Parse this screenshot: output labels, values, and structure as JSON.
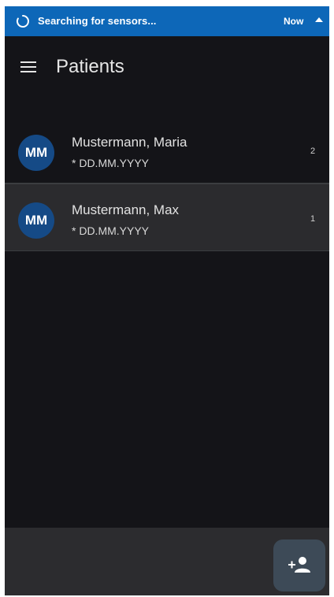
{
  "notification": {
    "message": "Searching for sensors...",
    "time": "Now",
    "spinner_icon": "loading-spinner-icon",
    "expand_icon": "caret-up-icon",
    "color": "#0d67b8"
  },
  "appbar": {
    "title": "Patients",
    "menu_icon": "hamburger-menu-icon"
  },
  "patients": [
    {
      "initials": "MM",
      "name": "Mustermann, Maria",
      "birth_date": "* DD.MM.YYYY",
      "count": "2",
      "selected": false
    },
    {
      "initials": "MM",
      "name": "Mustermann, Max",
      "birth_date": "* DD.MM.YYYY",
      "count": "1",
      "selected": true
    }
  ],
  "fab": {
    "icon": "add-person-icon"
  },
  "colors": {
    "background": "#141418",
    "avatar": "#154a86",
    "fab": "#3d4a57",
    "bottom_bar": "#2c2c2f"
  }
}
